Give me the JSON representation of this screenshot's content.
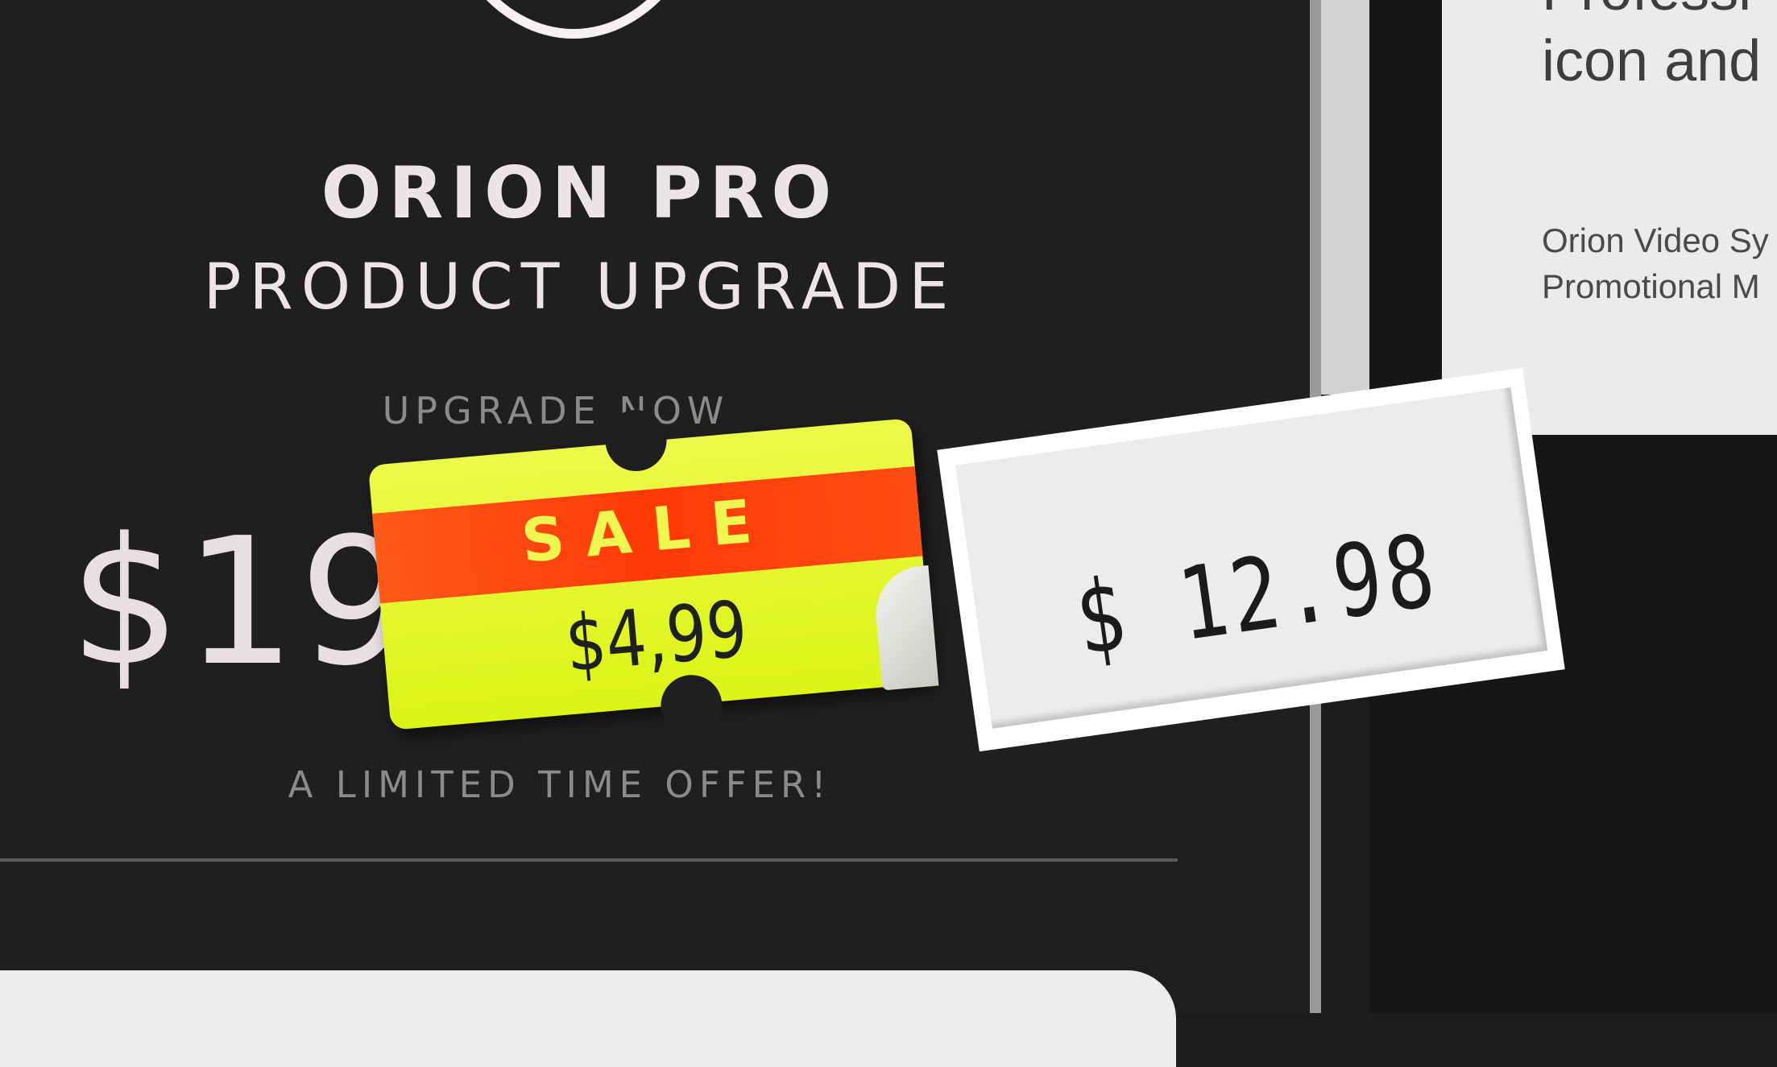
{
  "promo": {
    "title": "ORION PRO",
    "subtitle": "PRODUCT UPGRADE",
    "cta_heading": "UPGRADE NOW",
    "price": "$19",
    "offer": "A LIMITED TIME OFFER!"
  },
  "right_card": {
    "title_line_cut": "Professi",
    "title_line": "icon and",
    "desc_line1": "Orion Video Sy",
    "desc_line2": "Promotional M"
  },
  "stickers": {
    "sale_label": "SALE",
    "sale_price": "$4,99",
    "tag_price": "$ 12.98"
  },
  "colors": {
    "background": "#1f1f20",
    "sticker_yellow": "#dcf415",
    "sticker_red": "#ff3a06",
    "text_light": "#ede4e8"
  }
}
